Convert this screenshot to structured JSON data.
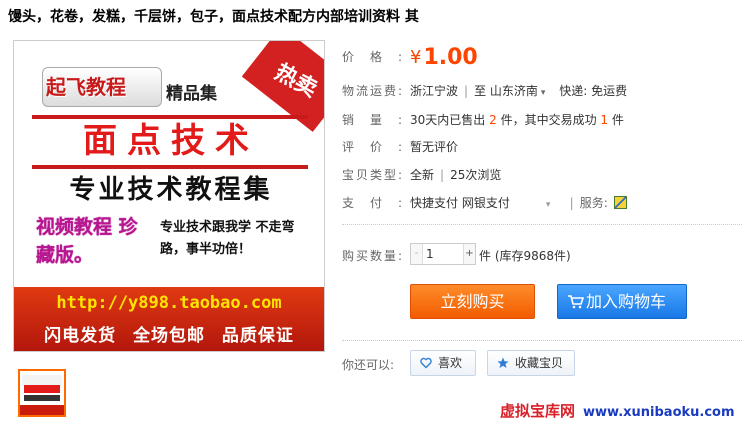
{
  "product": {
    "title": "馒头，花卷，发糕，千层饼，包子，面点技术配方内部培训资料 其"
  },
  "image": {
    "logo_text": "起飞教程",
    "collection_text": "精品集",
    "hot_badge": "热卖",
    "main_title": "面点技术",
    "subtitle": "专业技术教程集",
    "video_text": "视频教程 珍藏版。",
    "slogan": "专业技术跟我学 不走弯路，事半功倍！",
    "url": "http://y898.taobao.com",
    "promise": "闪电发货 全场包邮 品质保证"
  },
  "props": {
    "price_label": "价格:",
    "currency": "¥",
    "price": "1.00",
    "shipping_label": "物流运费:",
    "ship_from": "浙江宁波",
    "ship_to_prefix": "至",
    "ship_to": "山东济南",
    "delivery": "快递: 免运费",
    "sales_label": "销量:",
    "sales_prefix": "30天内已售出",
    "sales_count": "2",
    "sales_mid": "件，其中交易成功",
    "sales_success": "1",
    "sales_suffix": "件",
    "review_label": "评价:",
    "review_value": "暂无评价",
    "type_label": "宝贝类型:",
    "type_value": "全新",
    "views": "25次浏览",
    "pay_label": "支付:",
    "pay_value": "快捷支付  网银支付",
    "service_label": "服务:"
  },
  "purchase": {
    "qty_label": "购买数量:",
    "qty_value": "1",
    "minus": "-",
    "plus": "+",
    "stock_unit": "件 (库存9868件)",
    "buy_now": "立刻购买",
    "add_to_cart": "加入购物车"
  },
  "social": {
    "also_label": "你还可以:",
    "like": "喜欢",
    "favorite": "收藏宝贝"
  },
  "watermark": {
    "name": "虚拟宝库网",
    "url": "www.xunibaoku.com"
  },
  "colors": {
    "price": "#ff4400",
    "buy_button": "#f25c00",
    "cart_button": "#1978e6",
    "watermark": "#d8222a"
  }
}
